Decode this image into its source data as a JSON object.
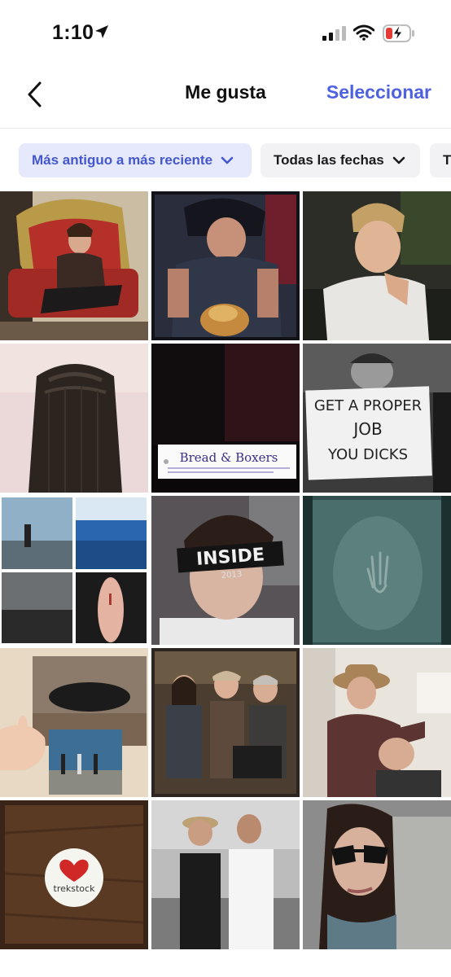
{
  "status": {
    "time": "1:10"
  },
  "nav": {
    "title": "Me gusta",
    "select_label": "Seleccionar",
    "back_icon": "chevron-left-icon"
  },
  "filters": {
    "sort_label": "Más antiguo a más reciente",
    "dates_label": "Todas las fechas",
    "third_label": "T"
  },
  "grid": {
    "sign_text_line1": "GET A PROPER",
    "sign_text_line2": "JOB",
    "sign_text_line3": "YOU DICKS",
    "tag_text": "Bread & Boxers",
    "headband_text": "INSIDE",
    "headband_year": "2013",
    "badge_text": "trekstock"
  },
  "colors": {
    "accent": "#4e62e0",
    "chip_active_bg": "#e6e9fb",
    "chip_bg": "#f2f2f4",
    "battery_red": "#e53935"
  }
}
